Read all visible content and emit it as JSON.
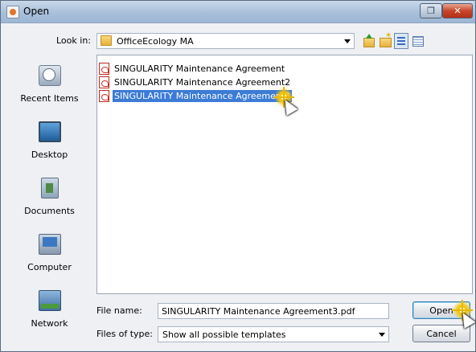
{
  "window": {
    "title": "Open"
  },
  "lookin": {
    "label": "Look in:",
    "value": "OfficeEcology MA"
  },
  "places": [
    {
      "label": "Recent Items",
      "icon": "recent-items-icon"
    },
    {
      "label": "Desktop",
      "icon": "desktop-icon"
    },
    {
      "label": "Documents",
      "icon": "documents-icon"
    },
    {
      "label": "Computer",
      "icon": "computer-icon"
    },
    {
      "label": "Network",
      "icon": "network-icon"
    }
  ],
  "files": [
    {
      "name": "SINGULARITY Maintenance Agreement",
      "selected": false
    },
    {
      "name": "SINGULARITY Maintenance Agreement2",
      "selected": false
    },
    {
      "name": "SINGULARITY Maintenance Agreement3",
      "selected": true
    }
  ],
  "filename": {
    "label": "File name:",
    "value": "SINGULARITY Maintenance Agreement3.pdf"
  },
  "filetype": {
    "label": "Files of type:",
    "value": "Show all possible templates"
  },
  "buttons": {
    "open": "Open",
    "cancel": "Cancel"
  },
  "colors": {
    "selection": "#3c7bd6",
    "close_button": "#c9462b",
    "pdf_icon": "#b82a22"
  }
}
